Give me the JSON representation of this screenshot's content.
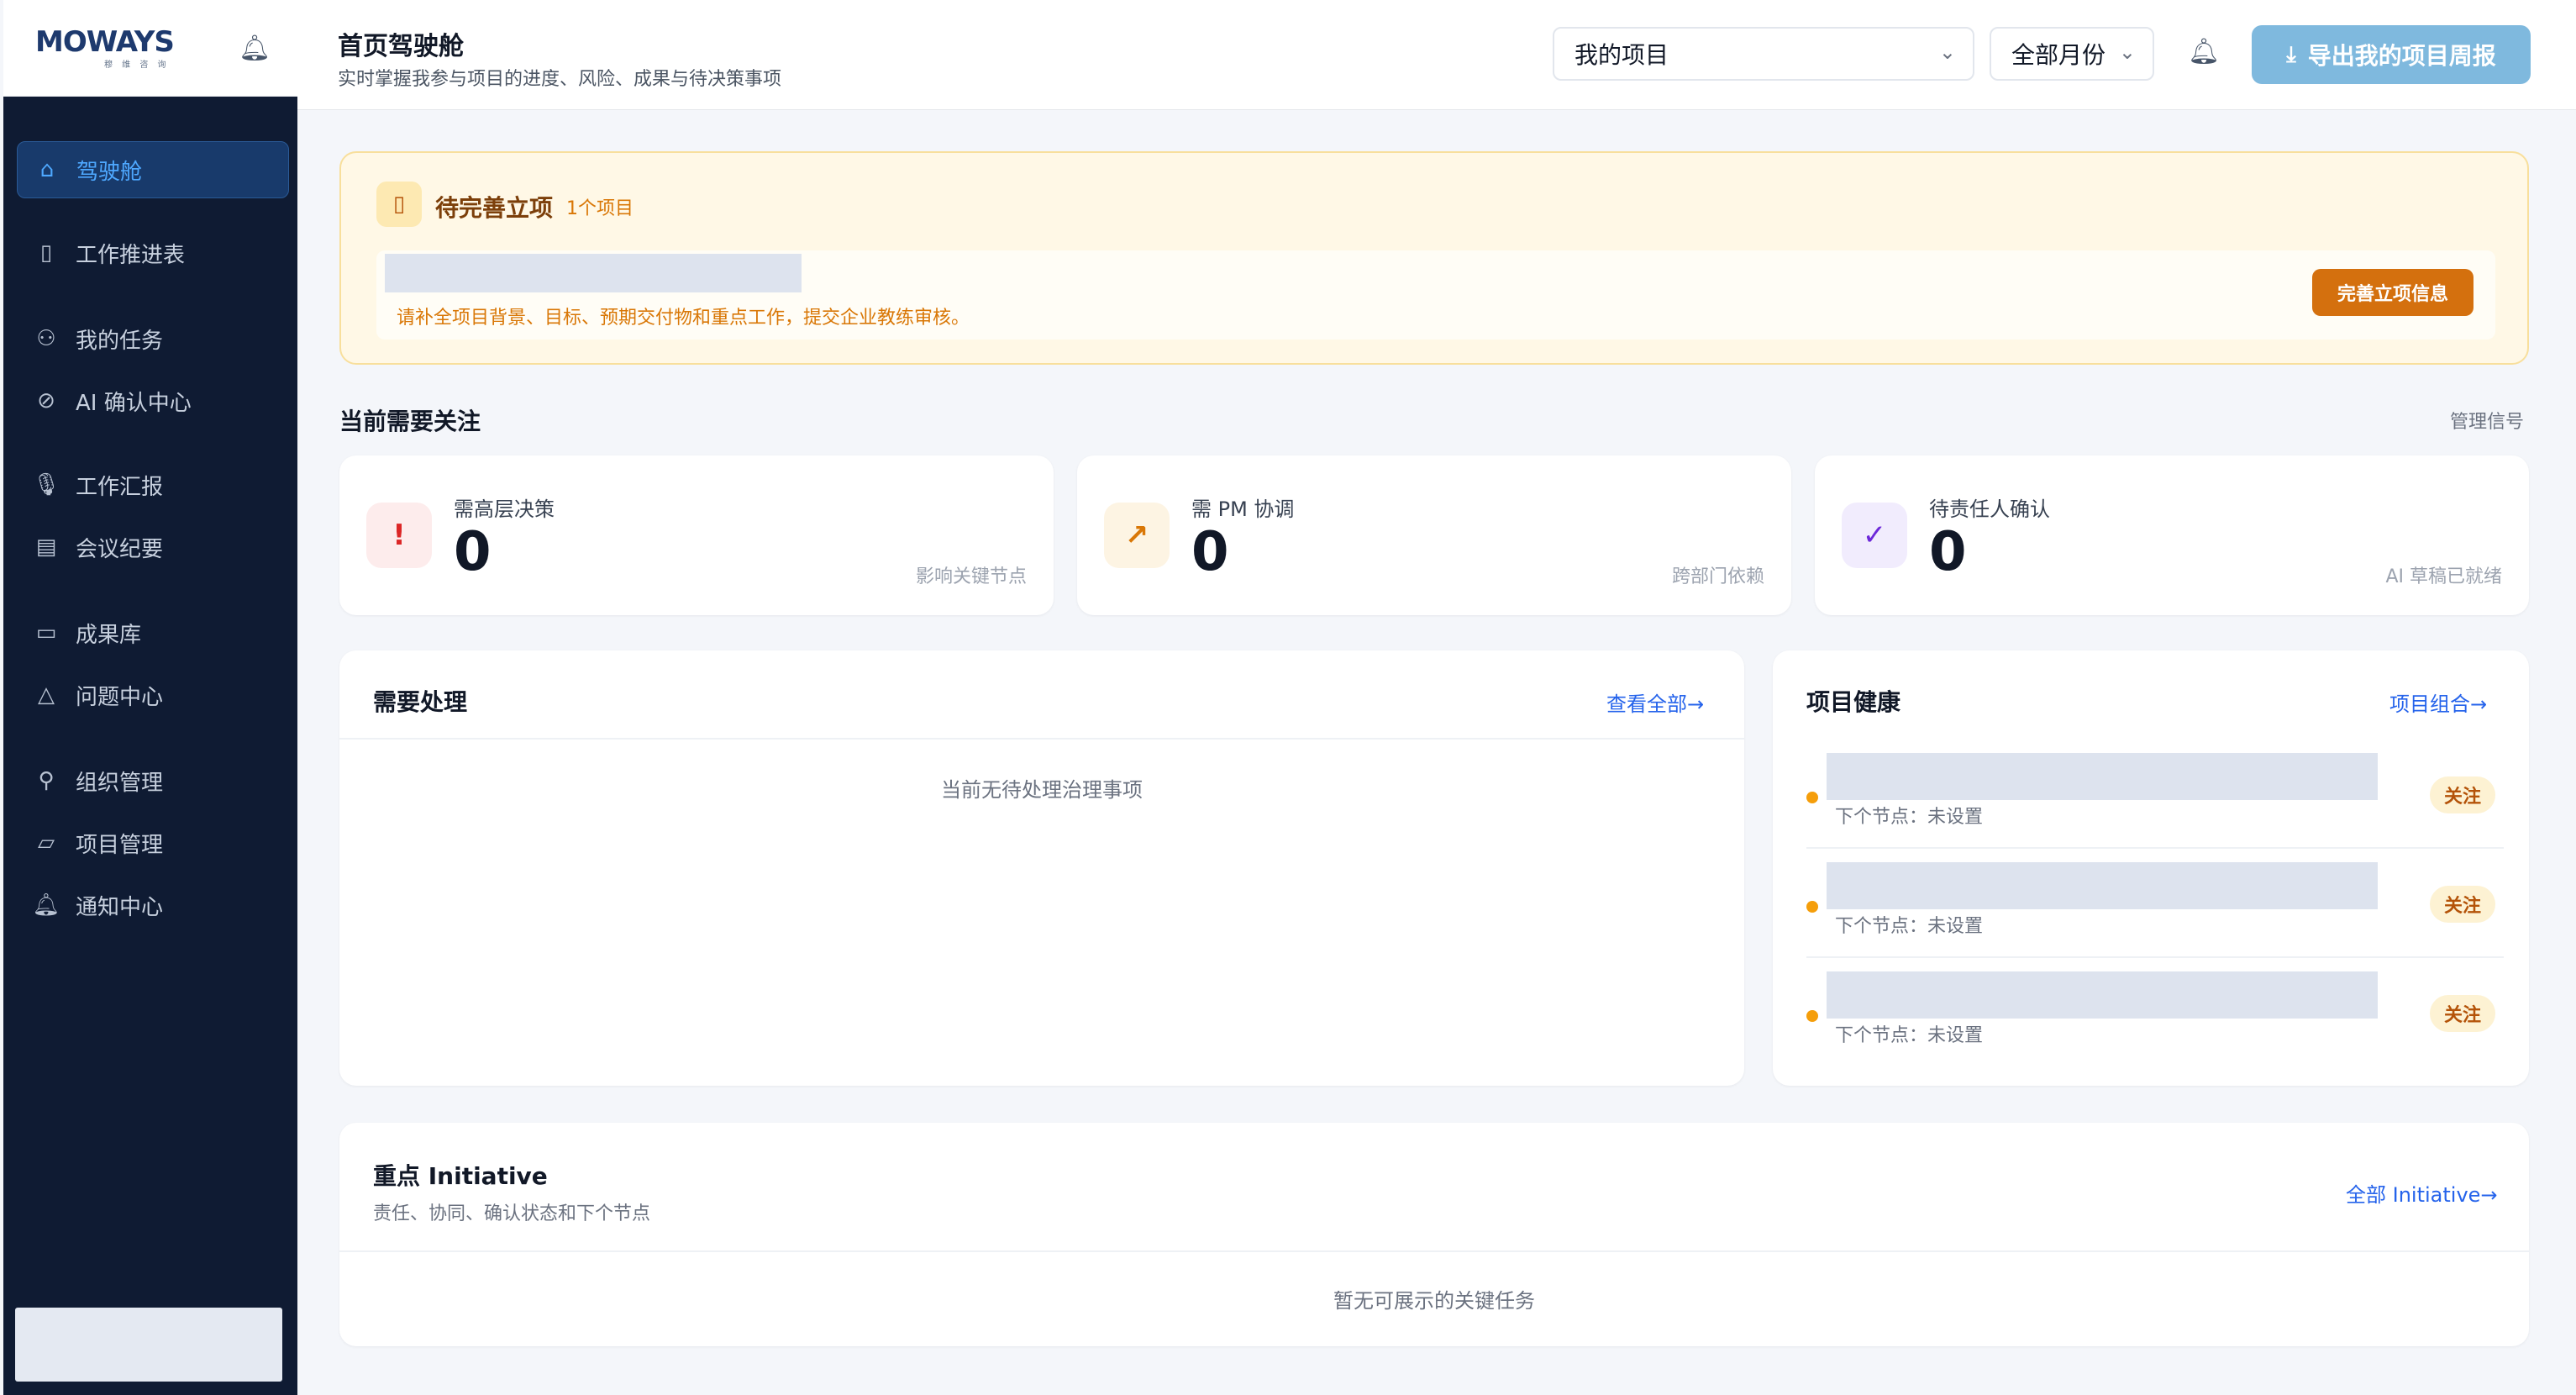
{
  "brand": {
    "logo_text": "MOWAYS",
    "logo_sub": "穆 维 咨 询"
  },
  "sidebar": {
    "items": [
      {
        "label": "驾驶舱",
        "icon": "home-icon",
        "active": true
      },
      {
        "label": "工作推进表",
        "icon": "clipboard-icon"
      },
      {
        "label": "我的任务",
        "icon": "user-icon"
      },
      {
        "label": "AI 确认中心",
        "icon": "check-circle-icon"
      },
      {
        "label": "工作汇报",
        "icon": "microphone-icon"
      },
      {
        "label": "会议纪要",
        "icon": "document-icon"
      },
      {
        "label": "成果库",
        "icon": "archive-icon"
      },
      {
        "label": "问题中心",
        "icon": "warning-icon"
      },
      {
        "label": "组织管理",
        "icon": "org-icon"
      },
      {
        "label": "项目管理",
        "icon": "folder-icon"
      },
      {
        "label": "通知中心",
        "icon": "bell-icon"
      }
    ]
  },
  "header": {
    "title": "首页驾驶舱",
    "subtitle": "实时掌握我参与项目的进度、风险、成果与待决策事项",
    "project_select": "我的项目",
    "month_select": "全部月份",
    "export_label": "导出我的项目周报"
  },
  "banner": {
    "title": "待完善立项",
    "count": "1个项目",
    "description": "请补全项目背景、目标、预期交付物和重点工作，提交企业教练审核。",
    "button": "完善立项信息"
  },
  "attention": {
    "title": "当前需要关注",
    "link": "管理信号",
    "cards": [
      {
        "label": "需高层决策",
        "value": "0",
        "note": "影响关键节点",
        "icon_glyph": "!",
        "color": "#dc2626",
        "bg": "#fdecec"
      },
      {
        "label": "需 PM 协调",
        "value": "0",
        "note": "跨部门依赖",
        "icon_glyph": "↗",
        "color": "#d97706",
        "bg": "#fdf4e3"
      },
      {
        "label": "待责任人确认",
        "value": "0",
        "note": "AI 草稿已就绪",
        "icon_glyph": "✓",
        "color": "#6d28d9",
        "bg": "#f1ecfd"
      }
    ]
  },
  "todo": {
    "title": "需要处理",
    "link": "查看全部→",
    "empty": "当前无待处理治理事项"
  },
  "health": {
    "title": "项目健康",
    "link": "项目组合→",
    "rows": [
      {
        "next": "下个节点：未设置",
        "badge": "关注"
      },
      {
        "next": "下个节点：未设置",
        "badge": "关注"
      },
      {
        "next": "下个节点：未设置",
        "badge": "关注"
      }
    ]
  },
  "initiative": {
    "title": "重点 Initiative",
    "subtitle": "责任、协同、确认状态和下个节点",
    "link": "全部 Initiative→",
    "empty": "暂无可展示的关键任务"
  },
  "colors": {
    "sidebar_bg": "#0f1b33",
    "accent": "#4ea8ff",
    "export_btn": "#7fb9de",
    "warning": "#d97706"
  }
}
